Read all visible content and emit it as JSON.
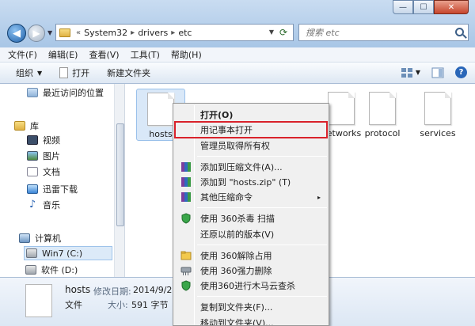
{
  "window": {
    "min_symbol": "—",
    "max_symbol": "☐",
    "close_symbol": "✕"
  },
  "address": {
    "crumbs": [
      "System32",
      "drivers",
      "etc"
    ],
    "lead_symbol": "«",
    "separator": "▸"
  },
  "search": {
    "placeholder": "搜索 etc"
  },
  "menubar": [
    "文件(F)",
    "编辑(E)",
    "查看(V)",
    "工具(T)",
    "帮助(H)"
  ],
  "toolbar": {
    "organize": "组织",
    "open": "打开",
    "new_folder": "新建文件夹",
    "help": "?"
  },
  "nav": {
    "recent": "最近访问的位置",
    "library": "库",
    "library_items": [
      "视频",
      "图片",
      "文档",
      "迅雷下载",
      "音乐"
    ],
    "computer": "计算机",
    "drives": [
      "Win7 (C:)",
      "软件 (D:)"
    ]
  },
  "files": [
    "hosts",
    "networks",
    "protocol",
    "services"
  ],
  "context_menu": {
    "open": "打开(O)",
    "open_notepad": "用记事本打开",
    "take_ownership": "管理员取得所有权",
    "add_archive": "添加到压缩文件(A)...",
    "add_zip": "添加到 \"hosts.zip\" (T)",
    "other_compress": "其他压缩命令",
    "scan_360": "使用 360杀毒 扫描",
    "restore": "还原以前的版本(V)",
    "unlock_360": "使用 360解除占用",
    "force_delete_360": "使用 360强力删除",
    "trojan_360": "使用360进行木马云查杀",
    "copy_to": "复制到文件夹(F)...",
    "move_to": "移动到文件夹(V)...",
    "submenu_arrow": "▸"
  },
  "details": {
    "name": "hosts",
    "type": "文件",
    "modified_label": "修改日期:",
    "modified_value": "2014/9/23",
    "size_label": "大小:",
    "size_value": "591 字节"
  }
}
